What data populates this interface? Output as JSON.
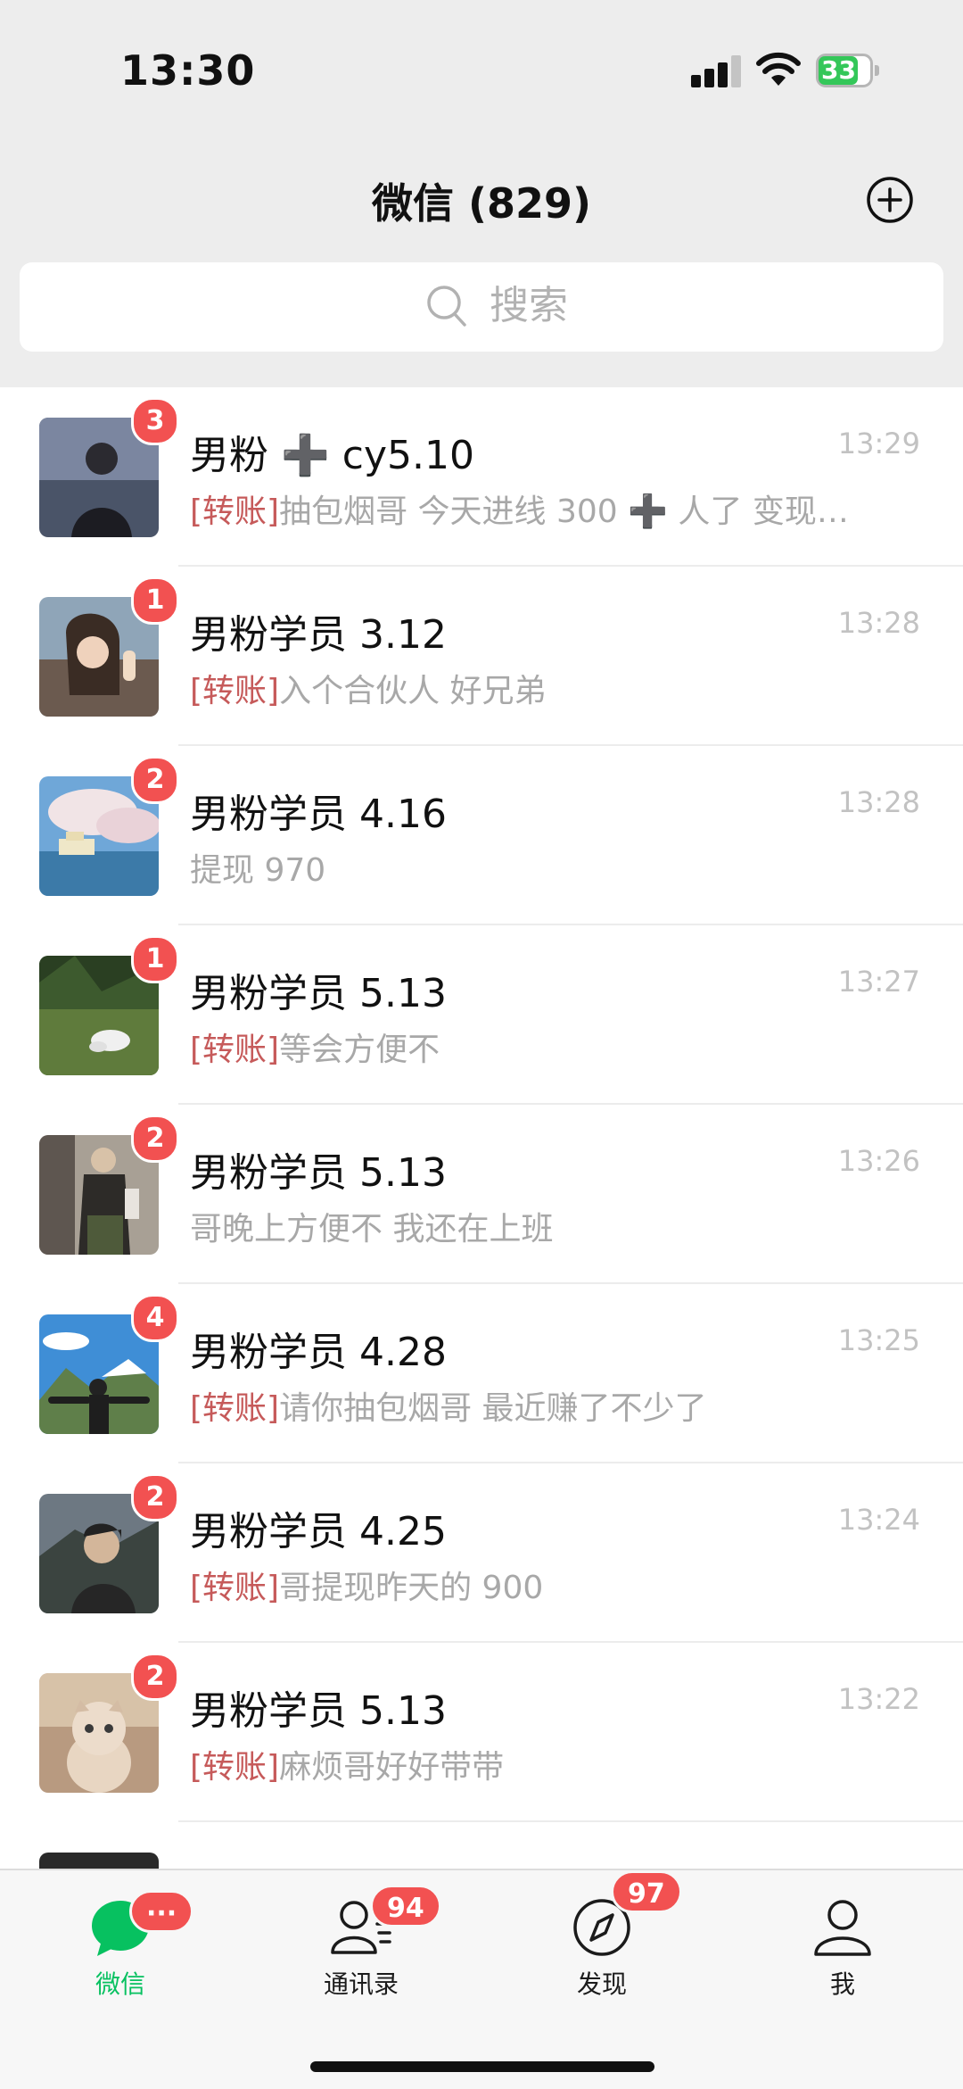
{
  "status_bar": {
    "time": "13:30",
    "battery": "33"
  },
  "header": {
    "title": "微信 (829)",
    "add_icon": "plus-circle-icon"
  },
  "search": {
    "placeholder": "搜索",
    "icon": "search-icon"
  },
  "chats": [
    {
      "name": "男粉 ➕ cy5.10",
      "time": "13:29",
      "badge": "3",
      "tag": "[转账]",
      "message": "抽包烟哥 今天进线 300 ➕ 人了 变现…"
    },
    {
      "name": "男粉学员 3.12",
      "time": "13:28",
      "badge": "1",
      "tag": "[转账]",
      "message": "入个合伙人 好兄弟"
    },
    {
      "name": "男粉学员 4.16",
      "time": "13:28",
      "badge": "2",
      "tag": "",
      "message": "提现 970"
    },
    {
      "name": "男粉学员 5.13",
      "time": "13:27",
      "badge": "1",
      "tag": "[转账]",
      "message": "等会方便不"
    },
    {
      "name": "男粉学员 5.13",
      "time": "13:26",
      "badge": "2",
      "tag": "",
      "message": "哥晚上方便不 我还在上班"
    },
    {
      "name": "男粉学员 4.28",
      "time": "13:25",
      "badge": "4",
      "tag": "[转账]",
      "message": "请你抽包烟哥 最近赚了不少了"
    },
    {
      "name": "男粉学员 4.25",
      "time": "13:24",
      "badge": "2",
      "tag": "[转账]",
      "message": "哥提现昨天的 900"
    },
    {
      "name": "男粉学员 5.13",
      "time": "13:22",
      "badge": "2",
      "tag": "[转账]",
      "message": "麻烦哥好好带带"
    }
  ],
  "tabs": [
    {
      "label": "微信",
      "badge": "···",
      "icon": "chat-bubble-icon",
      "active": true
    },
    {
      "label": "通讯录",
      "badge": "94",
      "icon": "contacts-icon",
      "active": false
    },
    {
      "label": "发现",
      "badge": "97",
      "icon": "compass-icon",
      "active": false
    },
    {
      "label": "我",
      "badge": "",
      "icon": "person-icon",
      "active": false
    }
  ],
  "colors": {
    "accent_green": "#07c160",
    "badge_red": "#f25151",
    "transfer_tag": "#c65a5a"
  }
}
